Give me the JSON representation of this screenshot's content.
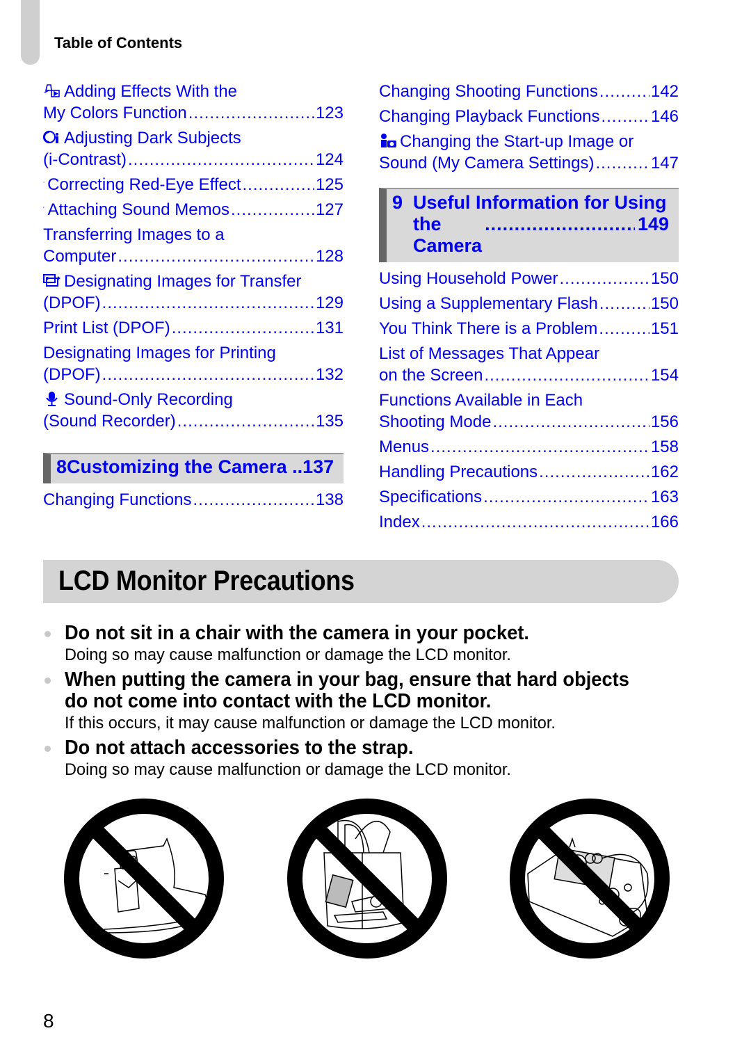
{
  "header": {
    "running_head": "Table of Contents"
  },
  "toc": {
    "left": [
      {
        "icon": "my-colors-icon",
        "lines": [
          "Adding Effects With the"
        ],
        "last": "My Colors Function",
        "page": "123"
      },
      {
        "icon": "i-contrast-icon",
        "lines": [
          "Adjusting Dark Subjects"
        ],
        "last": "(i-Contrast)",
        "page": "124"
      },
      {
        "icon": "red-eye-icon",
        "lines": [],
        "last": "Correcting Red-Eye Effect",
        "page": "125"
      },
      {
        "icon": "sound-memo-icon",
        "lines": [],
        "last": "Attaching Sound Memos",
        "page": "127"
      },
      {
        "icon": null,
        "lines": [
          "Transferring Images to a"
        ],
        "last": "Computer",
        "page": "128"
      },
      {
        "icon": "transfer-icon",
        "lines": [
          "Designating Images for Transfer"
        ],
        "last": "(DPOF)",
        "page": "129"
      },
      {
        "icon": null,
        "lines": [],
        "last": "Print List (DPOF)",
        "page": "131"
      },
      {
        "icon": null,
        "lines": [
          "Designating Images for Printing"
        ],
        "last": "(DPOF)",
        "page": "132"
      },
      {
        "icon": "microphone-icon",
        "lines": [
          "Sound-Only Recording"
        ],
        "last": "(Sound Recorder)",
        "page": "135"
      }
    ],
    "section8": {
      "number": "8",
      "title": "Customizing the Camera",
      "page": "137"
    },
    "left_after": [
      {
        "icon": null,
        "lines": [],
        "last": "Changing Functions",
        "page": "138"
      }
    ],
    "right": [
      {
        "icon": null,
        "lines": [],
        "last": "Changing Shooting Functions",
        "page": "142"
      },
      {
        "icon": null,
        "lines": [],
        "last": "Changing Playback Functions",
        "page": "146"
      },
      {
        "icon": "my-camera-icon",
        "lines": [
          "Changing the Start-up Image or"
        ],
        "last": "Sound (My Camera Settings)",
        "page": "147"
      }
    ],
    "section9": {
      "number": "9",
      "title_line1": "Useful Information for Using",
      "title_line2": "the Camera",
      "page": "149"
    },
    "right_after": [
      {
        "icon": null,
        "lines": [],
        "last": "Using Household Power",
        "page": "150"
      },
      {
        "icon": null,
        "lines": [],
        "last": "Using a Supplementary Flash",
        "page": "150"
      },
      {
        "icon": null,
        "lines": [],
        "last": "You Think There is a Problem",
        "page": "151"
      },
      {
        "icon": null,
        "lines": [
          "List of Messages That Appear"
        ],
        "last": "on the Screen",
        "page": "154"
      },
      {
        "icon": null,
        "lines": [
          "Functions Available in Each"
        ],
        "last": "Shooting Mode",
        "page": "156"
      },
      {
        "icon": null,
        "lines": [],
        "last": "Menus",
        "page": "158"
      },
      {
        "icon": null,
        "lines": [],
        "last": "Handling Precautions",
        "page": "162"
      },
      {
        "icon": null,
        "lines": [],
        "last": "Specifications",
        "page": "163"
      },
      {
        "icon": null,
        "lines": [],
        "last": "Index",
        "page": "166"
      }
    ]
  },
  "lcd": {
    "title": "LCD Monitor Precautions",
    "items": [
      {
        "heading": [
          "Do not sit in a chair with the camera in your pocket."
        ],
        "detail": "Doing so may cause malfunction or damage the LCD monitor."
      },
      {
        "heading": [
          "When putting the camera in your bag, ensure that hard objects",
          "do not come into contact with the LCD monitor."
        ],
        "detail": "If this occurs, it may cause malfunction or damage the LCD monitor."
      },
      {
        "heading": [
          "Do not attach accessories to the strap."
        ],
        "detail": "Doing so may cause malfunction or damage the LCD monitor."
      }
    ],
    "illustrations": [
      "prohibited-camera-in-pocket",
      "prohibited-camera-in-bag",
      "prohibited-accessories-on-strap"
    ]
  },
  "colors": {
    "link": "#0000ee",
    "section_bg": "#d9d9d9",
    "section_bar": "#666666",
    "banner_bg": "#d4d4d4"
  },
  "footer": {
    "page_number": "8"
  }
}
